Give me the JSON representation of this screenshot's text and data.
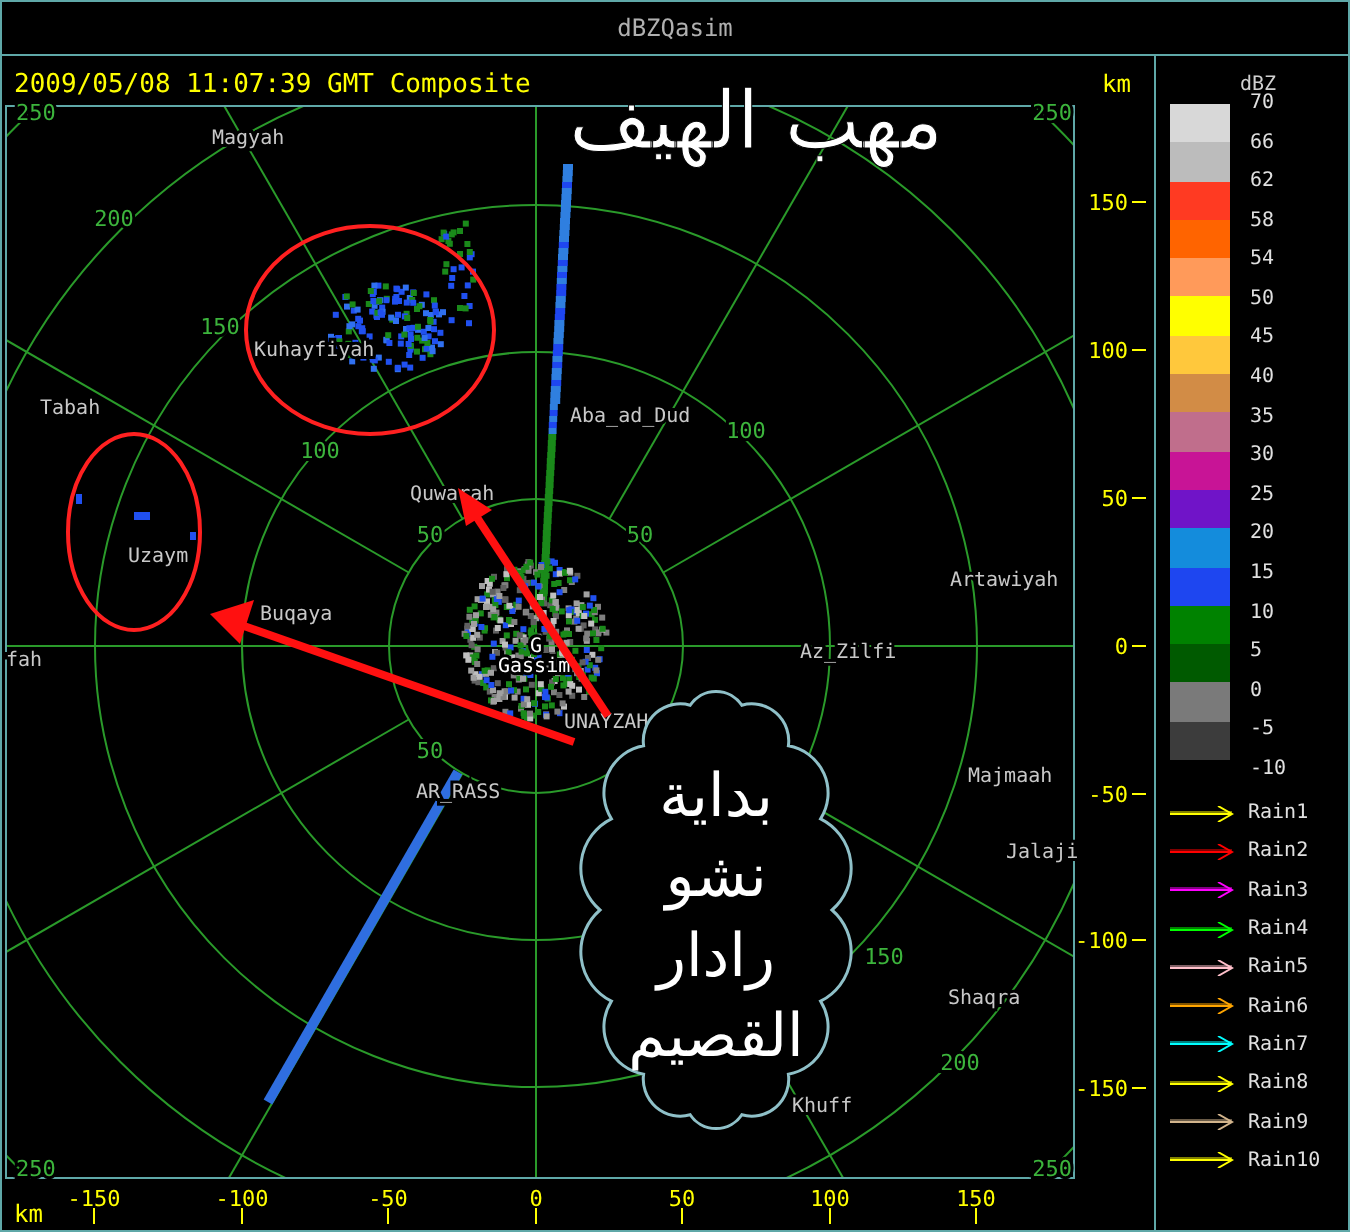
{
  "title": "dBZQasim",
  "plot": {
    "timestamp": "2009/05/08 11:07:39 GMT Composite",
    "unit_label": "km",
    "overlay_title": "مهب الهيف",
    "ring_labels": [
      "250",
      "200",
      "150",
      "100",
      "50",
      "50",
      "100",
      "250",
      "50",
      "150",
      "200",
      "250",
      "250"
    ],
    "places": [
      {
        "name": "Magyah",
        "kind": "city"
      },
      {
        "name": "Kuhayfiyah",
        "kind": "city"
      },
      {
        "name": "Tabah",
        "kind": "city"
      },
      {
        "name": "Aba_ad_Dud",
        "kind": "city"
      },
      {
        "name": "Quwarah",
        "kind": "city"
      },
      {
        "name": "Uzaym",
        "kind": "city"
      },
      {
        "name": "Artawiyah",
        "kind": "city"
      },
      {
        "name": "fah",
        "kind": "city"
      },
      {
        "name": "Buqaya",
        "kind": "city"
      },
      {
        "name": "G",
        "kind": "radar"
      },
      {
        "name": "Gassim",
        "kind": "radar"
      },
      {
        "name": "Az_Zilfi",
        "kind": "city"
      },
      {
        "name": "UNAYZAH",
        "kind": "city"
      },
      {
        "name": "AR_RASS",
        "kind": "city"
      },
      {
        "name": "Majmaah",
        "kind": "city"
      },
      {
        "name": "Jalaji",
        "kind": "city"
      },
      {
        "name": "Shaqra",
        "kind": "city"
      },
      {
        "name": "Khuff",
        "kind": "city"
      }
    ],
    "callout": {
      "lines": [
        "بداية",
        "نشو",
        "رادار",
        "القصيم"
      ]
    },
    "y_axis": {
      "ticks": [
        "150",
        "100",
        "50",
        "0",
        "-50",
        "-100",
        "-150"
      ]
    },
    "x_axis": {
      "unit": "km",
      "ticks": [
        "-150",
        "-100",
        "-50",
        "0",
        "50",
        "100",
        "150"
      ]
    }
  },
  "legend": {
    "title": "dBZ",
    "bands": [
      {
        "color": "#d8d8d8"
      },
      {
        "color": "#bcbcbc"
      },
      {
        "color": "#ff3a22"
      },
      {
        "color": "#ff6400"
      },
      {
        "color": "#ff9a5a"
      },
      {
        "color": "#ffff00"
      },
      {
        "color": "#ffc83c"
      },
      {
        "color": "#d28c46"
      },
      {
        "color": "#c06e8c"
      },
      {
        "color": "#c81496"
      },
      {
        "color": "#7014c8"
      },
      {
        "color": "#148cdc"
      },
      {
        "color": "#1e46f0"
      },
      {
        "color": "#008200"
      },
      {
        "color": "#005a00"
      },
      {
        "color": "#7a7a7a"
      },
      {
        "color": "#3c3c3c"
      }
    ],
    "labels": [
      "70",
      "66",
      "62",
      "58",
      "54",
      "50",
      "45",
      "40",
      "35",
      "30",
      "25",
      "20",
      "15",
      "10",
      "5",
      "0",
      "-5",
      "-10"
    ],
    "rain": [
      {
        "label": "Rain1",
        "color": "#ffff00"
      },
      {
        "label": "Rain2",
        "color": "#ff0000"
      },
      {
        "label": "Rain3",
        "color": "#ff00ff"
      },
      {
        "label": "Rain4",
        "color": "#00ff00"
      },
      {
        "label": "Rain5",
        "color": "#ffc0cb"
      },
      {
        "label": "Rain6",
        "color": "#ffa500"
      },
      {
        "label": "Rain7",
        "color": "#00ffff"
      },
      {
        "label": "Rain8",
        "color": "#ffff00"
      },
      {
        "label": "Rain9",
        "color": "#d2b48c"
      },
      {
        "label": "Rain10",
        "color": "#ffff00"
      }
    ]
  }
}
